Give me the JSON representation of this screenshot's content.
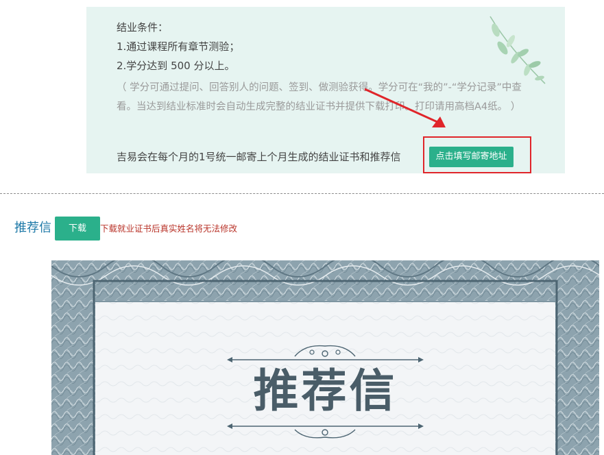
{
  "graduation": {
    "heading": "结业条件：",
    "condition_1": "1.通过课程所有章节测验；",
    "condition_2": "2.学分达到 500 分以上。",
    "note": "（ 学分可通过提问、回答别人的问题、签到、做测验获得。学分可在“我的”-“学分记录”中查看。当达到结业标准时会自动生成完整的结业证书并提供下载打印。打印请用高档A4纸。 ）",
    "mail_notice": "吉易会在每个月的1号统一邮寄上个月生成的结业证书和推荐信",
    "fill_address_button": "点击填写邮寄地址"
  },
  "recommendation": {
    "section_title": "推荐信",
    "download_button": "下载",
    "warning": "下载就业证书后真实姓名将无法修改",
    "certificate_title": "推荐信"
  },
  "colors": {
    "panel_bg": "#e6f4f1",
    "accent_green": "#2bb08b",
    "highlight_red": "#e0252a",
    "title_blue": "#1f7aa8",
    "warning_red": "#b9342a",
    "certificate_slate": "#4a5d68"
  },
  "icons": {
    "leaf": "leaf-decoration-icon",
    "arrow": "arrow-pointer-icon"
  }
}
